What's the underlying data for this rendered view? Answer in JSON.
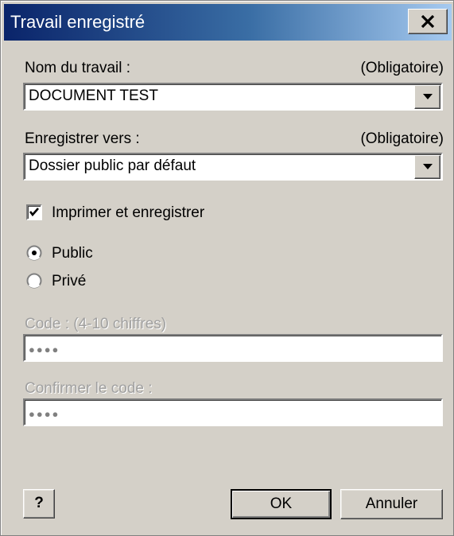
{
  "window": {
    "title": "Travail enregistré"
  },
  "job_name": {
    "label": "Nom du travail :",
    "required": "(Obligatoire)",
    "value": "DOCUMENT TEST"
  },
  "save_to": {
    "label": "Enregistrer vers :",
    "required": "(Obligatoire)",
    "value": "Dossier public par défaut"
  },
  "print_and_save": {
    "label": "Imprimer et enregistrer",
    "checked": true
  },
  "visibility": {
    "options": [
      {
        "label": "Public",
        "selected": true
      },
      {
        "label": "Privé",
        "selected": false
      }
    ]
  },
  "code": {
    "label": "Code : (4-10 chiffres)",
    "value": "●●●●"
  },
  "confirm_code": {
    "label": "Confirmer le code :",
    "value": "●●●●"
  },
  "buttons": {
    "help": "?",
    "ok": "OK",
    "cancel": "Annuler"
  }
}
